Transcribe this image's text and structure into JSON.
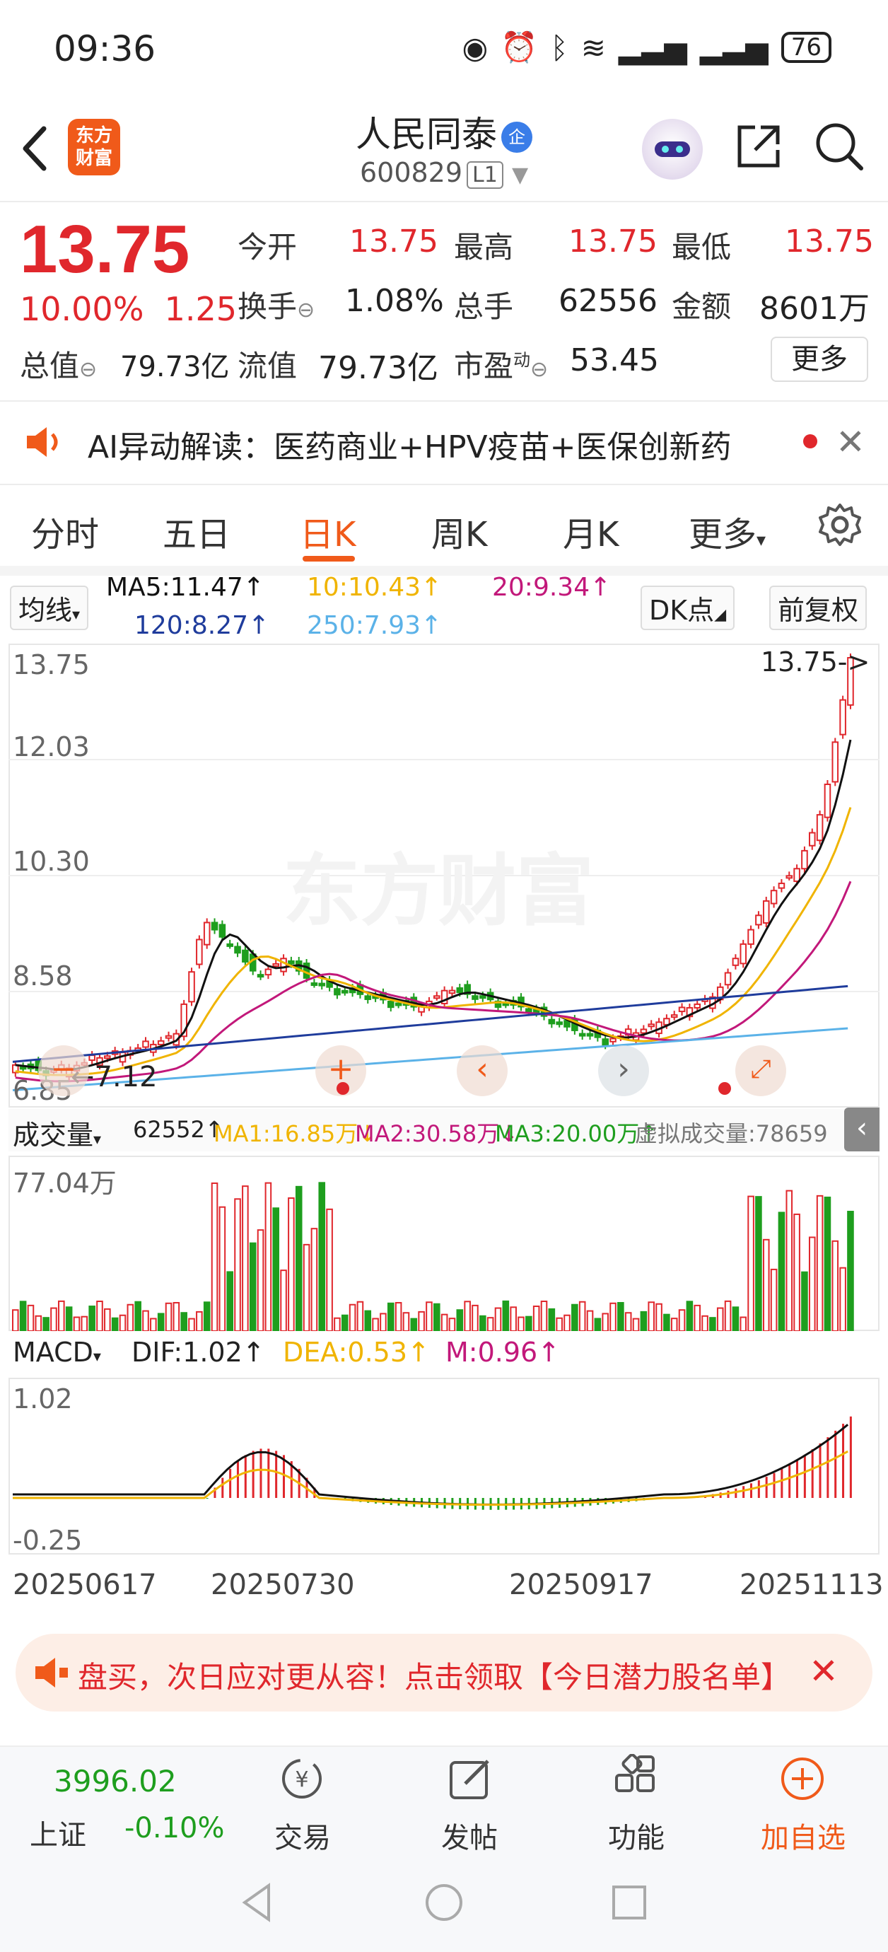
{
  "status_bar": {
    "time": "09:36",
    "battery": "76"
  },
  "header": {
    "logo_line1": "东方",
    "logo_line2": "财富",
    "stock_name": "人民同泰",
    "badge": "企",
    "stock_code": "600829",
    "level": "L1"
  },
  "quote": {
    "price": "13.75",
    "change_pct": "10.00%",
    "change_abs": "1.25",
    "open_label": "今开",
    "open": "13.75",
    "high_label": "最高",
    "high": "13.75",
    "low_label": "最低",
    "low": "13.75",
    "turnover_label": "换手",
    "turnover": "1.08%",
    "volume_label": "总手",
    "volume": "62556",
    "amount_label": "金额",
    "amount": "8601万",
    "mktcap_label": "总值",
    "mktcap": "79.73亿",
    "float_label": "流值",
    "float": "79.73亿",
    "pe_label": "市盈",
    "pe_sup": "动",
    "pe": "53.45",
    "more_label": "更多"
  },
  "ai_banner": {
    "text": "AI异动解读：医药商业+HPV疫苗+医保创新药"
  },
  "tabs": [
    "分时",
    "五日",
    "日K",
    "周K",
    "月K",
    "更多"
  ],
  "active_tab": "日K",
  "ma_row": {
    "selector": "均线",
    "ma5": "MA5:11.47↑",
    "ma10": "10:10.43↑",
    "ma20": "20:9.34↑",
    "ma120": "120:8.27↑",
    "ma250": "250:7.93↑",
    "dk_label": "DK点",
    "fq_label": "前复权"
  },
  "colors": {
    "up": "#e0272c",
    "down": "#1e9e1e",
    "ma5": "#111111",
    "ma10": "#f0b400",
    "ma20": "#c2187a",
    "ma120": "#1f3c9c",
    "ma250": "#5bb2e8",
    "accent": "#f05a1a"
  },
  "chart_data": {
    "type": "candlestick",
    "y_labels": [
      "13.75",
      "12.03",
      "10.30",
      "8.58",
      "6.85"
    ],
    "ylim": [
      6.85,
      13.75
    ],
    "latest_marker": "13.75->",
    "low_marker": "7.12",
    "x_labels": [
      "20250617",
      "20250730",
      "20250917",
      "20251113"
    ],
    "watermark": "东方财富",
    "price_path": [
      7.3,
      7.2,
      7.25,
      7.4,
      7.5,
      7.6,
      7.8,
      9.6,
      9.2,
      8.7,
      9.0,
      8.6,
      8.5,
      8.4,
      8.3,
      8.2,
      8.5,
      8.4,
      8.3,
      8.2,
      8.0,
      7.8,
      7.7,
      7.8,
      8.0,
      8.2,
      8.4,
      9.2,
      10.0,
      10.4,
      11.4,
      13.75
    ]
  },
  "volume": {
    "selector": "成交量",
    "value": "62552↑",
    "ma1": "MA1:16.85万↓",
    "ma2": "MA2:30.58万↓",
    "ma3": "MA3:20.00万↑",
    "virtual": "虚拟成交量:78659",
    "max_label": "77.04万"
  },
  "macd": {
    "selector": "MACD",
    "dif": "DIF:1.02↑",
    "dea": "DEA:0.53↑",
    "m": "M:0.96↑",
    "top_label": "1.02",
    "bottom_label": "-0.25"
  },
  "promo": {
    "text": "盘买，次日应对更从容！点击领取【今日潜力股名单】"
  },
  "bottom_nav": {
    "index_value": "3996.02",
    "index_name": "上证",
    "index_change": "-0.10%",
    "items": [
      "交易",
      "发帖",
      "功能",
      "加自选"
    ]
  }
}
